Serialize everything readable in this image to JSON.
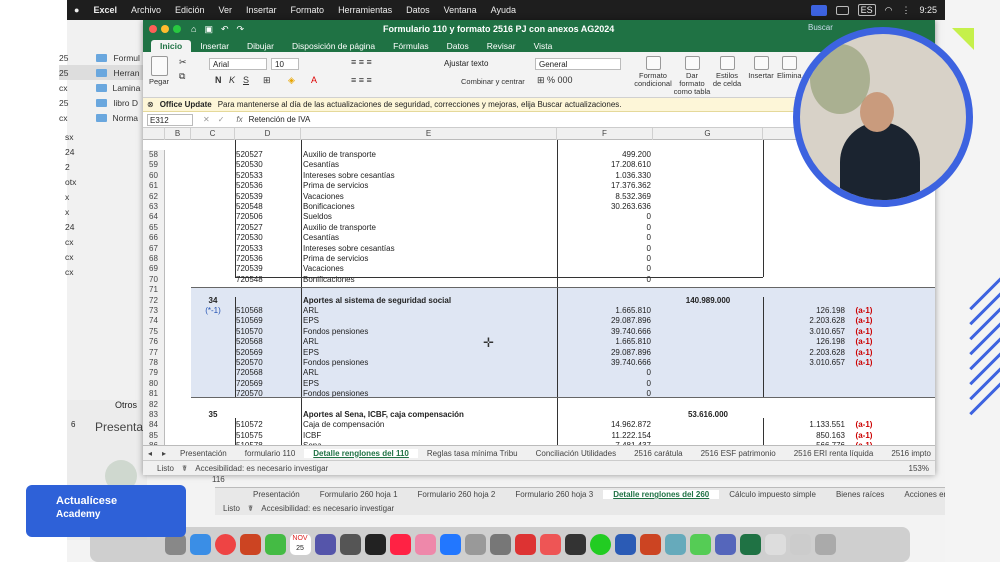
{
  "mac_menu": {
    "apple": "",
    "app": "Excel",
    "items": [
      "Archivo",
      "Edición",
      "Ver",
      "Insertar",
      "Formato",
      "Herramientas",
      "Datos",
      "Ventana",
      "Ayuda"
    ],
    "input_badge": "ES",
    "time": "9:25"
  },
  "finder": {
    "items": [
      {
        "num": "25",
        "name": "Formul"
      },
      {
        "num": "25",
        "name": "Herran"
      },
      {
        "num": "cx",
        "name": "Lamina"
      },
      {
        "num": "25",
        "name": "libro D"
      },
      {
        "num": "cx",
        "name": "Norma"
      }
    ],
    "left_nums": [
      "sx",
      "24",
      "2",
      "otx",
      "x",
      "x",
      "24",
      "cx",
      "cx",
      "cx"
    ],
    "other_text": "Otros",
    "presenta": "Presentac",
    "num6": "6"
  },
  "excel": {
    "title": "Formulario 110 y formato 2516 PJ con anexos AG2024",
    "search_placeholder": "Buscar",
    "tabs": [
      "Inicio",
      "Insertar",
      "Dibujar",
      "Disposición de página",
      "Fórmulas",
      "Datos",
      "Revisar",
      "Vista"
    ],
    "ribbon": {
      "paste": "Pegar",
      "font": "Arial",
      "size": "10",
      "wrap": "Ajustar texto",
      "merge": "Combinar y centrar",
      "format": "General",
      "cond": "Formato condicional",
      "table": "Dar formato como tabla",
      "styles": "Estilos de celda",
      "insert": "Insertar",
      "delete": "Elimina"
    },
    "notice": {
      "tag": "Office Update",
      "text": "Para mantenerse al día de las actualizaciones de seguridad, correcciones y mejoras, elija Buscar actualizaciones."
    },
    "namebox": "E312",
    "formula": "Retención de IVA",
    "fx": "fx",
    "columns": [
      "B",
      "C",
      "D",
      "E",
      "F",
      "G"
    ],
    "rows": [
      {
        "n": "58",
        "d": "520527",
        "e": "Auxilio de transporte",
        "f": "499.200"
      },
      {
        "n": "59",
        "d": "520530",
        "e": "Cesantías",
        "f": "17.208.610"
      },
      {
        "n": "60",
        "d": "520533",
        "e": "Intereses sobre cesantías",
        "f": "1.036.330"
      },
      {
        "n": "61",
        "d": "520536",
        "e": "Prima de servicios",
        "f": "17.376.362"
      },
      {
        "n": "62",
        "d": "520539",
        "e": "Vacaciones",
        "f": "8.532.369"
      },
      {
        "n": "63",
        "d": "520548",
        "e": "Bonificaciones",
        "f": "30.263.636"
      },
      {
        "n": "64",
        "d": "720506",
        "e": "Sueldos",
        "f": "0"
      },
      {
        "n": "65",
        "d": "720527",
        "e": "Auxilio de transporte",
        "f": "0"
      },
      {
        "n": "66",
        "d": "720530",
        "e": "Cesantías",
        "f": "0"
      },
      {
        "n": "67",
        "d": "720533",
        "e": "Intereses sobre cesantías",
        "f": "0"
      },
      {
        "n": "68",
        "d": "720536",
        "e": "Prima de servicios",
        "f": "0"
      },
      {
        "n": "69",
        "d": "720539",
        "e": "Vacaciones",
        "f": "0"
      },
      {
        "n": "70",
        "d": "720548",
        "e": "Bonificaciones",
        "f": "0"
      },
      {
        "n": "71"
      },
      {
        "n": "72",
        "c": "34",
        "e": "Aportes al sistema de seguridad social",
        "g": "140.989.000",
        "bold": true
      },
      {
        "n": "73",
        "c": "(*-1)",
        "d": "510568",
        "e": "ARL",
        "f": "1.665.810",
        "h": "126.198",
        "i": "(a-1)"
      },
      {
        "n": "74",
        "d": "510569",
        "e": "EPS",
        "f": "29.087.896",
        "h": "2.203.628",
        "i": "(a-1)"
      },
      {
        "n": "75",
        "d": "510570",
        "e": "Fondos pensiones",
        "f": "39.740.666",
        "h": "3.010.657",
        "i": "(a-1)"
      },
      {
        "n": "76",
        "d": "520568",
        "e": "ARL",
        "f": "1.665.810",
        "h": "126.198",
        "i": "(a-1)"
      },
      {
        "n": "77",
        "d": "520569",
        "e": "EPS",
        "f": "29.087.896",
        "h": "2.203.628",
        "i": "(a-1)"
      },
      {
        "n": "78",
        "d": "520570",
        "e": "Fondos pensiones",
        "f": "39.740.666",
        "h": "3.010.657",
        "i": "(a-1)"
      },
      {
        "n": "79",
        "d": "720568",
        "e": "ARL",
        "f": "0"
      },
      {
        "n": "80",
        "d": "720569",
        "e": "EPS",
        "f": "0"
      },
      {
        "n": "81",
        "d": "720570",
        "e": "Fondos pensiones",
        "f": "0"
      },
      {
        "n": "82"
      },
      {
        "n": "83",
        "c": "35",
        "e": "Aportes al Sena, ICBF, caja compensación",
        "g": "53.616.000",
        "bold": true
      },
      {
        "n": "84",
        "d": "510572",
        "e": "Caja de compensación",
        "f": "14.962.872",
        "h": "1.133.551",
        "i": "(a-1)"
      },
      {
        "n": "85",
        "d": "510575",
        "e": "ICBF",
        "f": "11.222.154",
        "h": "850.163",
        "i": "(a-1)"
      },
      {
        "n": "86",
        "d": "510578",
        "e": "Sena",
        "f": "7.481.437",
        "h": "566.776",
        "i": "(a-1)"
      }
    ],
    "sheet_tabs": [
      "Presentación",
      "formulario 110",
      "Detalle renglones del 110",
      "Reglas tasa mínima Tribu",
      "Conciliación Utilidades",
      "2516 carátula",
      "2516 ESF patrimonio",
      "2516 ERI renta líquida",
      "2516 impto"
    ],
    "active_tab": "Detalle renglones del 110",
    "status": {
      "ready": "Listo",
      "access": "Accesibilidad: es necesario investigar",
      "zoom": "153%"
    }
  },
  "window2": {
    "tabs": [
      "Presentación",
      "Formulario 260 hoja 1",
      "Formulario 260 hoja 2",
      "Formulario 260 hoja 3",
      "Detalle renglones del 260",
      "Cálculo impuesto simple",
      "Bienes raíces",
      "Acciones en sociedad"
    ],
    "active_tab": "Detalle renglones del 260",
    "status_ready": "Listo",
    "access": "Accesibilidad: es necesario investigar",
    "num": "116"
  },
  "brand": {
    "line1": "Actualícese",
    "line2": "Academy"
  },
  "dock": {
    "calendar_month": "NOV",
    "calendar_day": "25"
  }
}
